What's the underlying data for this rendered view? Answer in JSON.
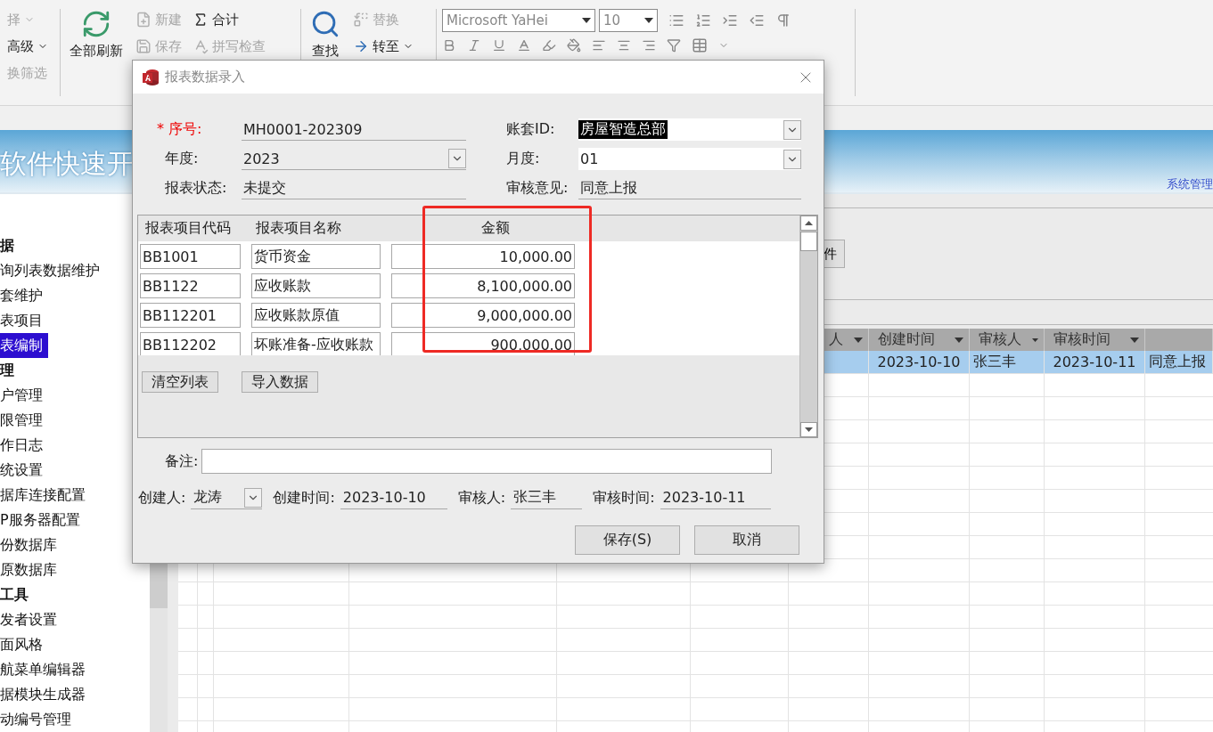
{
  "ribbon": {
    "sort_items": [
      {
        "label": "择",
        "disabled": true,
        "dropdown": true
      },
      {
        "label": "高级",
        "disabled": false,
        "dropdown": true
      },
      {
        "label": "换筛选",
        "disabled": true,
        "dropdown": false
      }
    ],
    "refresh_button": "全部刷新",
    "record_items": [
      {
        "label": "新建",
        "disabled": true
      },
      {
        "label": "保存",
        "disabled": true
      },
      {
        "label": "合计",
        "disabled": false
      },
      {
        "label": "拼写检查",
        "disabled": true
      }
    ],
    "find_button": "查找",
    "find_items": [
      {
        "label": "替换",
        "disabled": true,
        "dropdown": false
      },
      {
        "label": "转至",
        "disabled": false,
        "dropdown": true
      }
    ],
    "font": "Microsoft YaHei",
    "font_size": "10"
  },
  "banner": {
    "title": "软件快速开",
    "subtitle": "系统管理"
  },
  "sidebar": {
    "items": [
      {
        "kind": "section",
        "label": "据",
        "selected": false
      },
      {
        "kind": "item",
        "label": "询列表数据维护",
        "selected": false
      },
      {
        "kind": "item",
        "label": "套维护",
        "selected": false
      },
      {
        "kind": "item",
        "label": "表项目",
        "selected": false
      },
      {
        "kind": "item",
        "label": "表编制",
        "selected": true
      },
      {
        "kind": "section",
        "label": "理",
        "selected": false
      },
      {
        "kind": "item",
        "label": "户管理",
        "selected": false
      },
      {
        "kind": "item",
        "label": "限管理",
        "selected": false
      },
      {
        "kind": "item",
        "label": "作日志",
        "selected": false
      },
      {
        "kind": "item",
        "label": "统设置",
        "selected": false
      },
      {
        "kind": "item",
        "label": "据库连接配置",
        "selected": false
      },
      {
        "kind": "item",
        "label": "P服务器配置",
        "selected": false
      },
      {
        "kind": "item",
        "label": "份数据库",
        "selected": false
      },
      {
        "kind": "item",
        "label": "原数据库",
        "selected": false
      },
      {
        "kind": "section",
        "label": "工具",
        "selected": false
      },
      {
        "kind": "item",
        "label": "发者设置",
        "selected": false
      },
      {
        "kind": "item",
        "label": "面风格",
        "selected": false
      },
      {
        "kind": "item",
        "label": "航菜单编辑器",
        "selected": false
      },
      {
        "kind": "item",
        "label": "据模块生成器",
        "selected": false
      },
      {
        "kind": "item",
        "label": "动编号管理",
        "selected": false
      }
    ]
  },
  "content": {
    "partial_button": "件",
    "table": {
      "columns": [
        "人",
        "创建时间",
        "审核人",
        "审核时间"
      ],
      "rows": [
        {
          "selected": true,
          "created_time": "2023-10-10",
          "reviewer": "张三丰",
          "review_time": "2023-10-11",
          "column_5": "同意上报"
        }
      ]
    }
  },
  "dialog": {
    "title": "报表数据录入",
    "fields": [
      {
        "kind": "text",
        "label": "* 序号:",
        "required": true,
        "value": "MH0001-202309",
        "highlighted": false
      },
      {
        "kind": "combo",
        "label": "账套ID:",
        "required": false,
        "value": "房屋智造总部",
        "highlighted": true
      },
      {
        "kind": "combo",
        "label": "年度:",
        "required": false,
        "value": "2023",
        "highlighted": false
      },
      {
        "kind": "combo",
        "label": "月度:",
        "required": false,
        "value": "01",
        "highlighted": false
      },
      {
        "kind": "text",
        "label": "报表状态:",
        "required": false,
        "value": "未提交",
        "highlighted": false
      },
      {
        "kind": "text",
        "label": "审核意见:",
        "required": false,
        "value": "同意上报",
        "highlighted": false
      }
    ],
    "subform": {
      "columns": [
        "报表项目代码",
        "报表项目名称",
        "金额"
      ],
      "rows": [
        {
          "code": "BB1001",
          "name": "货币资金",
          "amount": "10,000.00"
        },
        {
          "code": "BB1122",
          "name": "应收账款",
          "amount": "8,100,000.00"
        },
        {
          "code": "BB112201",
          "name": "应收账款原值",
          "amount": "9,000,000.00"
        },
        {
          "code": "BB112202",
          "name": "坏账准备-应收账款",
          "amount": "900,000.00"
        }
      ],
      "buttons": [
        "清空列表",
        "导入数据"
      ]
    },
    "remark_label": "备注:",
    "footer_fields": [
      {
        "kind": "combo",
        "label": "创建人:",
        "value": "龙涛"
      },
      {
        "kind": "text",
        "label": "创建时间:",
        "value": "2023-10-10"
      },
      {
        "kind": "text",
        "label": "审核人:",
        "value": "张三丰"
      },
      {
        "kind": "text",
        "label": "审核时间:",
        "value": "2023-10-11"
      }
    ],
    "buttons": [
      "保存(S)",
      "取消"
    ]
  }
}
